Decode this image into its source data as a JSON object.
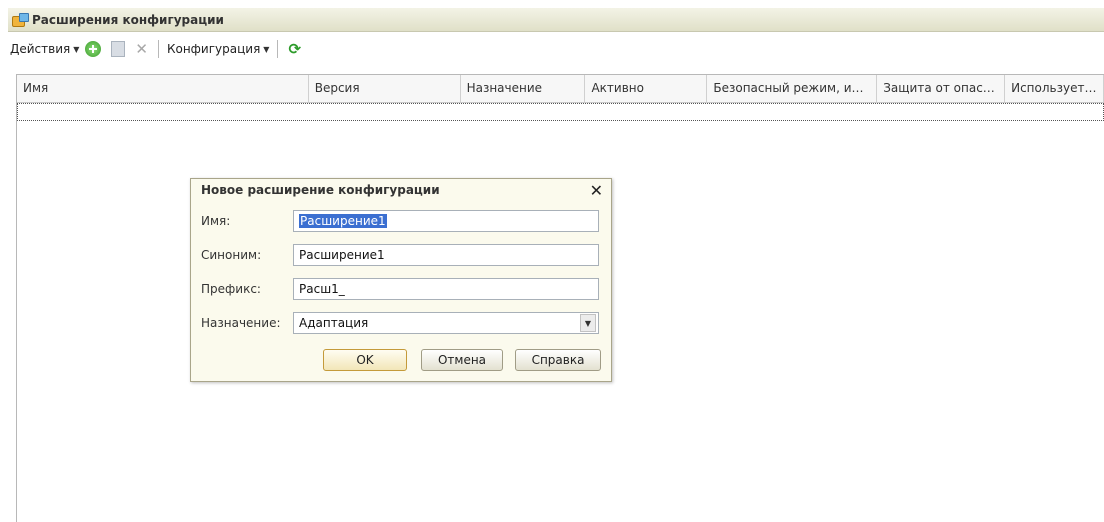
{
  "window": {
    "title": "Расширения конфигурации"
  },
  "toolbar": {
    "actions_label": "Действия",
    "configuration_label": "Конфигурация"
  },
  "table": {
    "columns": [
      "Имя",
      "Версия",
      "Назначение",
      "Активно",
      "Безопасный режим, им...",
      "Защита от опасн...",
      "Используется в"
    ],
    "rows": []
  },
  "dialog": {
    "title": "Новое расширение конфигурации",
    "fields": {
      "name": {
        "label": "Имя:",
        "value": "Расширение1"
      },
      "synonym": {
        "label": "Синоним:",
        "value": "Расширение1"
      },
      "prefix": {
        "label": "Префикс:",
        "value": "Расш1_"
      },
      "purpose": {
        "label": "Назначение:",
        "value": "Адаптация"
      }
    },
    "buttons": {
      "ok": "OK",
      "cancel": "Отмена",
      "help": "Справка"
    }
  },
  "icons": {
    "add": "add-icon",
    "copy": "document-icon",
    "delete": "delete-icon",
    "refresh": "refresh-icon",
    "close": "close-icon",
    "app": "extensions-icon"
  },
  "colors": {
    "titlebar": "#e8e8d4",
    "dialog_bg": "#fbfaed",
    "selection": "#3b6fd1"
  }
}
